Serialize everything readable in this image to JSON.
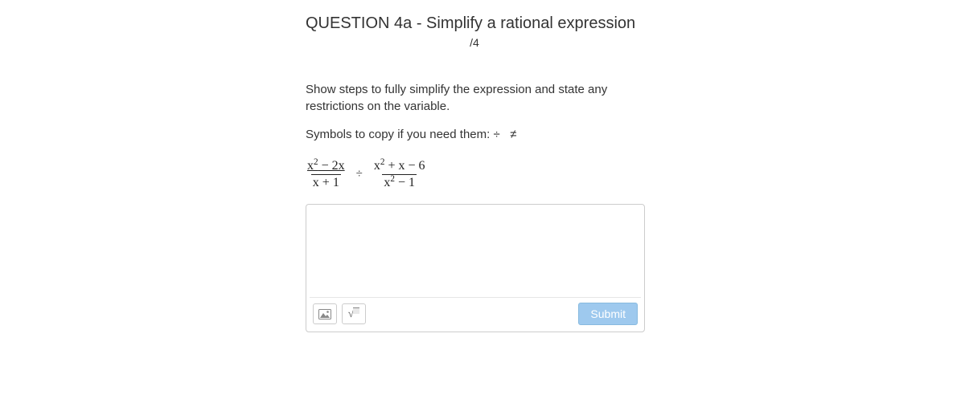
{
  "header": {
    "title": "QUESTION 4a - Simplify a rational expression",
    "marks": "/4"
  },
  "body": {
    "instructions": "Show steps to fully simplify the expression and state any restrictions on the variable.",
    "symbols_prefix": "Symbols to copy if you need them: ",
    "symbol_divide": "÷",
    "symbol_neq": "≠"
  },
  "expression": {
    "frac1_num_a": "x",
    "frac1_num_b": " − 2x",
    "frac1_den": "x + 1",
    "div": "÷",
    "frac2_num_a": "x",
    "frac2_num_b": " + x − 6",
    "frac2_den_a": "x",
    "frac2_den_b": " − 1",
    "exp": "2"
  },
  "answer": {
    "value": ""
  },
  "toolbar": {
    "submit_label": "Submit"
  }
}
